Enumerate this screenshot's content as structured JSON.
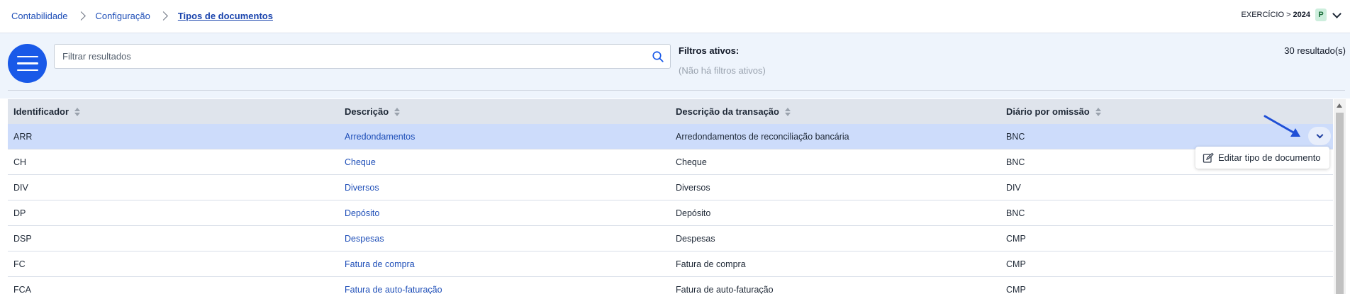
{
  "breadcrumb": {
    "items": [
      "Contabilidade",
      "Configuração"
    ],
    "current": "Tipos de documentos"
  },
  "header": {
    "exercicio_label": "EXERCÍCIO >",
    "exercicio_year": "2024",
    "user_badge": "P"
  },
  "filter": {
    "search_placeholder": "Filtrar resultados",
    "active_filters_title": "Filtros ativos:",
    "active_filters_empty": "(Não há filtros ativos)",
    "results_count": "30 resultado(s)"
  },
  "table": {
    "columns": [
      "Identificador",
      "Descrição",
      "Descrição da transação",
      "Diário por omissão"
    ],
    "rows": [
      {
        "id": "ARR",
        "descricao": "Arredondamentos",
        "transacao": "Arredondamentos de reconciliação bancária",
        "diario": "BNC"
      },
      {
        "id": "CH",
        "descricao": "Cheque",
        "transacao": "Cheque",
        "diario": "BNC"
      },
      {
        "id": "DIV",
        "descricao": "Diversos",
        "transacao": "Diversos",
        "diario": "DIV"
      },
      {
        "id": "DP",
        "descricao": "Depósito",
        "transacao": "Depósito",
        "diario": "BNC"
      },
      {
        "id": "DSP",
        "descricao": "Despesas",
        "transacao": "Despesas",
        "diario": "CMP"
      },
      {
        "id": "FC",
        "descricao": "Fatura de compra",
        "transacao": "Fatura de compra",
        "diario": "CMP"
      },
      {
        "id": "FCA",
        "descricao": "Fatura de auto-faturação",
        "transacao": "Fatura de auto-faturação",
        "diario": "CMP"
      }
    ]
  },
  "row_menu": {
    "edit_label": "Editar tipo de documento"
  },
  "colors": {
    "accent": "#1959e8",
    "link": "#1f4fb8",
    "selected_row": "#cddcfb",
    "header_bg": "#dfe4ec",
    "filter_bg": "#eef4fc"
  }
}
